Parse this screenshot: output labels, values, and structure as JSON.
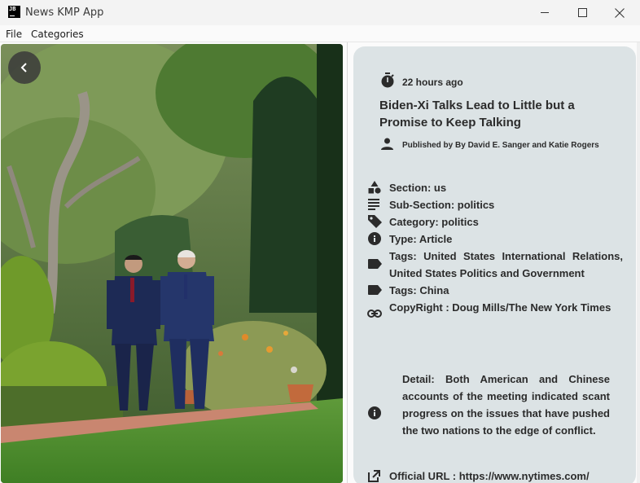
{
  "window": {
    "app_icon_text": "JB",
    "title": "News KMP App"
  },
  "menu": {
    "items": [
      "File",
      "Categories"
    ]
  },
  "article": {
    "time": "22 hours ago",
    "headline": "Biden-Xi Talks Lead to Little but a Promise to Keep Talking",
    "byline": "Published by By David E. Sanger and Katie Rogers",
    "section": "Section: us",
    "subsection": "Sub-Section: politics",
    "category": "Category: politics",
    "type": "Type: Article",
    "tags1": "Tags: United States International Relations, United States Politics and Government",
    "tags2": "Tags: China",
    "copyright": "CopyRight : Doug Mills/The New York Times",
    "detail": "Detail: Both American and Chinese accounts of the meeting indicated scant progress on the issues that have pushed the two nations to the edge of conflict.",
    "official_url": "Official URL : https://www.nytimes.com/"
  },
  "icons": {
    "back": "arrow-back-icon",
    "time": "timer-icon",
    "author": "person-icon",
    "section": "category-shapes-icon",
    "subsection": "subject-lines-icon",
    "category": "tag-icon",
    "type": "info-icon",
    "tags": "label-icon",
    "copyright": "link-icon",
    "detail": "info-icon",
    "url": "open-in-new-icon"
  },
  "colors": {
    "card_bg": "#dce3e5",
    "text": "#2b2b2b",
    "back_button": "#3a3a3a"
  }
}
